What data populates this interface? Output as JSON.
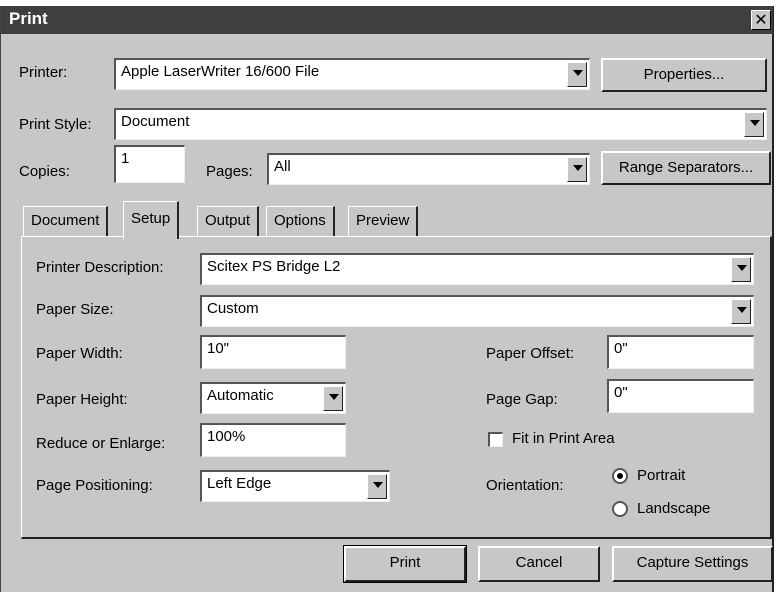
{
  "window": {
    "title": "Print",
    "close_glyph": "✕"
  },
  "printer": {
    "label": "Printer:",
    "value": "Apple LaserWriter 16/600 File",
    "properties_button": "Properties..."
  },
  "print_style": {
    "label": "Print Style:",
    "value": "Document"
  },
  "copies": {
    "label": "Copies:",
    "value": "1"
  },
  "pages": {
    "label": "Pages:",
    "value": "All",
    "range_button": "Range Separators..."
  },
  "tabs": [
    "Document",
    "Setup",
    "Output",
    "Options",
    "Preview"
  ],
  "active_tab": "Setup",
  "setup": {
    "printer_description": {
      "label": "Printer Description:",
      "value": "Scitex PS Bridge L2"
    },
    "paper_size": {
      "label": "Paper Size:",
      "value": "Custom"
    },
    "paper_width": {
      "label": "Paper Width:",
      "value": "10\""
    },
    "paper_height": {
      "label": "Paper Height:",
      "value": "Automatic"
    },
    "reduce_enlarge": {
      "label": "Reduce or Enlarge:",
      "value": "100%"
    },
    "page_positioning": {
      "label": "Page Positioning:",
      "value": "Left Edge"
    },
    "paper_offset": {
      "label": "Paper Offset:",
      "value": "0\""
    },
    "page_gap": {
      "label": "Page Gap:",
      "value": "0\""
    },
    "fit_in_print_area": {
      "label": "Fit in Print Area",
      "checked": false
    },
    "orientation": {
      "label": "Orientation:",
      "options": [
        "Portrait",
        "Landscape"
      ],
      "selected": "Portrait"
    }
  },
  "buttons": {
    "print": "Print",
    "cancel": "Cancel",
    "capture": "Capture Settings"
  }
}
